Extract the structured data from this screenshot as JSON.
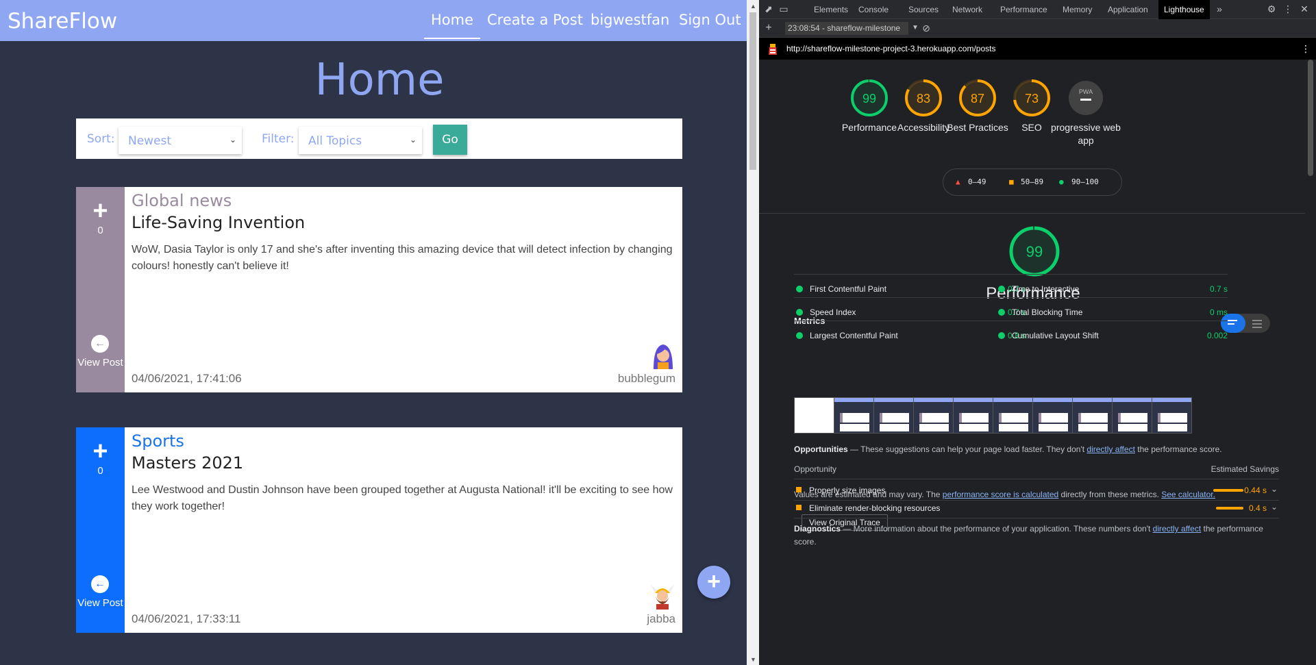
{
  "app": {
    "brand": "ShareFlow",
    "nav": [
      "Home",
      "Create a Post",
      "bigwestfan",
      "Sign Out"
    ],
    "page_title": "Home",
    "sort": {
      "label": "Sort:",
      "value": "Newest"
    },
    "filter": {
      "label": "Filter:",
      "value": "All Topics"
    },
    "go_label": "Go",
    "posts": [
      {
        "topic": "Global news",
        "topic_color": "#9a8a9f",
        "side_color": "#9a8a9f",
        "title": "Life-Saving Invention",
        "body": "WoW, Dasia Taylor is only 17 and she's after inventing this amazing device that will detect infection by changing colours! honestly can't believe it!",
        "votes": "0",
        "view_label": "View Post",
        "date": "04/06/2021, 17:41:06",
        "author": "bubblegum",
        "avatar_icon": "girl-avatar-icon"
      },
      {
        "topic": "Sports",
        "topic_color": "#1a73e8",
        "side_color": "#0d6efd",
        "title": "Masters 2021",
        "body": "Lee Westwood and Dustin Johnson have been grouped together at Augusta National! it'll be exciting to see how they work together!",
        "votes": "0",
        "view_label": "View Post",
        "date": "04/06/2021, 17:33:11",
        "author": "jabba",
        "avatar_icon": "viking-avatar-icon"
      }
    ],
    "fab_icon": "plus-icon",
    "colors": {
      "nav": "#8fa7f3",
      "background": "#2d3447",
      "go": "#3bab99"
    }
  },
  "devtools": {
    "tabs": [
      "Elements",
      "Console",
      "Sources",
      "Network",
      "Performance",
      "Memory",
      "Application",
      "Lighthouse"
    ],
    "active_tab": "Lighthouse",
    "report_select": "23:08:54 - shareflow-milestone",
    "url": "http://shareflow-milestone-project-3.herokuapp.com/posts",
    "gauges": [
      {
        "label": "Performance",
        "score": 99,
        "color": "#0cce6b"
      },
      {
        "label": "Accessibility",
        "score": 83,
        "color": "#ffa400"
      },
      {
        "label": "Best Practices",
        "score": 87,
        "color": "#ffa400"
      },
      {
        "label": "SEO",
        "score": 73,
        "color": "#ffa400"
      },
      {
        "label": "progressive web app",
        "score": null,
        "badge": "PWA",
        "color": "#888888"
      }
    ],
    "legend": [
      "0–49",
      "50–89",
      "90–100"
    ],
    "performance": {
      "score": 99,
      "title": "Performance",
      "metrics_title": "Metrics",
      "metrics": [
        {
          "name": "First Contentful Paint",
          "value": "0.7 s"
        },
        {
          "name": "Time to Interactive",
          "value": "0.7 s"
        },
        {
          "name": "Speed Index",
          "value": "0.7 s"
        },
        {
          "name": "Total Blocking Time",
          "value": "0 ms"
        },
        {
          "name": "Largest Contentful Paint",
          "value": "0.8 s"
        },
        {
          "name": "Cumulative Layout Shift",
          "value": "0.002"
        }
      ],
      "note_prefix": "Values are estimated and may vary. The ",
      "note_link1": "performance score is calculated",
      "note_mid": " directly from these metrics. ",
      "note_link2": "See calculator.",
      "trace_button": "View Original Trace"
    },
    "opportunities": {
      "title": "Opportunities",
      "desc_prefix": " — These suggestions can help your page load faster. They don't ",
      "desc_link": "directly affect",
      "desc_suffix": " the performance score.",
      "col_left": "Opportunity",
      "col_right": "Estimated Savings",
      "items": [
        {
          "name": "Properly size images",
          "value": "0.44 s",
          "fraction": 0.44
        },
        {
          "name": "Eliminate render-blocking resources",
          "value": "0.4 s",
          "fraction": 0.4
        }
      ]
    },
    "diagnostics": {
      "title": "Diagnostics",
      "desc_prefix": " — More information about the performance of your application. These numbers don't ",
      "desc_link": "directly affect",
      "desc_suffix": " the performance score."
    }
  }
}
